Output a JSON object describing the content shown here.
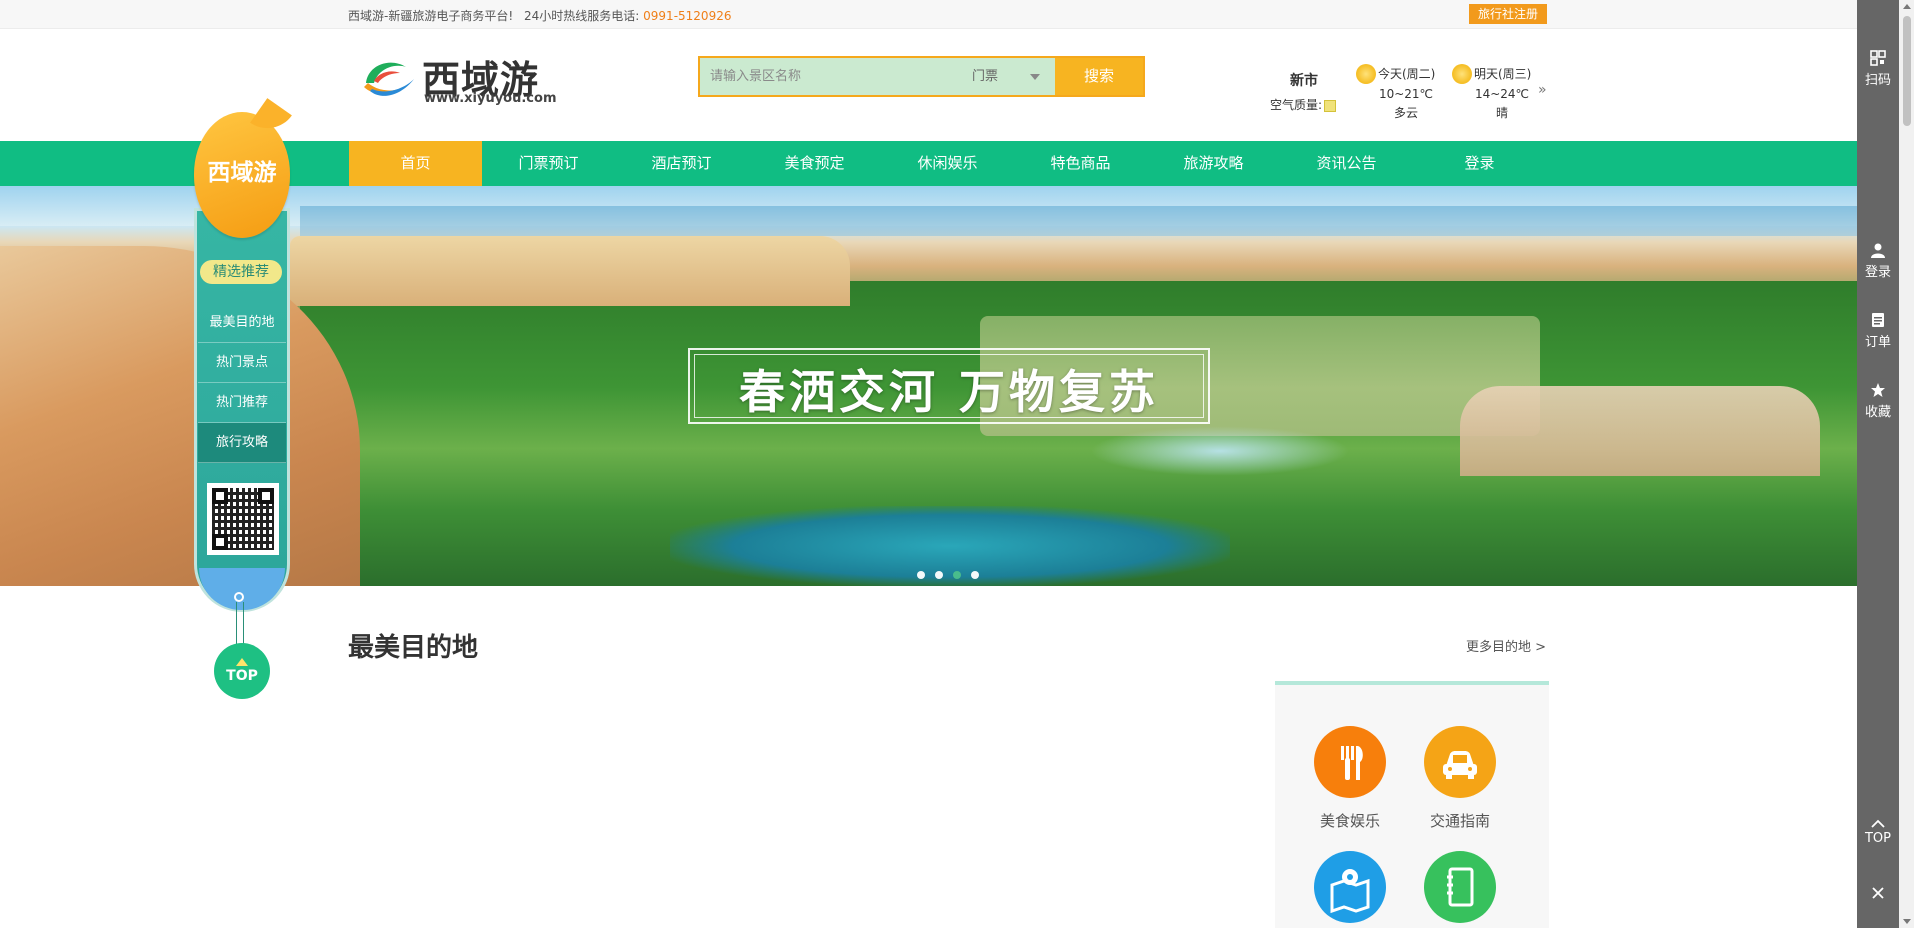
{
  "topbar": {
    "intro": "西域游-新疆旅游电子商务平台!",
    "hotline_label": "24小时热线服务电话:",
    "hotline_number": "0991-5120926",
    "agency_register": "旅行社注册"
  },
  "header": {
    "logo_name": "西域游",
    "logo_url": "www.xiyuyou.com",
    "search": {
      "placeholder": "请输入景区名称",
      "category": "门票",
      "button": "搜索"
    },
    "weather": {
      "city": "新市",
      "air_quality_label": "空气质量:",
      "today": {
        "name": "今天(周二)",
        "temp": "10~21℃",
        "desc": "多云"
      },
      "tomorrow": {
        "name": "明天(周三)",
        "temp": "14~24℃",
        "desc": "晴"
      },
      "more": "»"
    }
  },
  "nav": {
    "items": [
      "首页",
      "门票预订",
      "酒店预订",
      "美食预定",
      "休闲娱乐",
      "特色商品",
      "旅游攻略",
      "资讯公告",
      "登录"
    ],
    "active_index": 0
  },
  "banner": {
    "title": "春洒交河 万物复苏",
    "slides": 4,
    "active_slide": 3
  },
  "float_nav": {
    "brand": "西域游",
    "pick": "精选推荐",
    "items": [
      "最美目的地",
      "热门景点",
      "热门推荐",
      "旅行攻略"
    ],
    "active_index": 3,
    "top": "TOP"
  },
  "content": {
    "section_title": "最美目的地",
    "more_link": "更多目的地 >",
    "services": [
      "美食娱乐",
      "交通指南"
    ]
  },
  "right_toolbar": {
    "scan": "扫码",
    "login": "登录",
    "orders": "订单",
    "favorites": "收藏",
    "top": "TOP"
  },
  "colors": {
    "nav_green": "#10bd83",
    "accent_orange": "#f7b421",
    "hotline_orange": "#ef7f19",
    "toolbar_gray": "#666666"
  }
}
